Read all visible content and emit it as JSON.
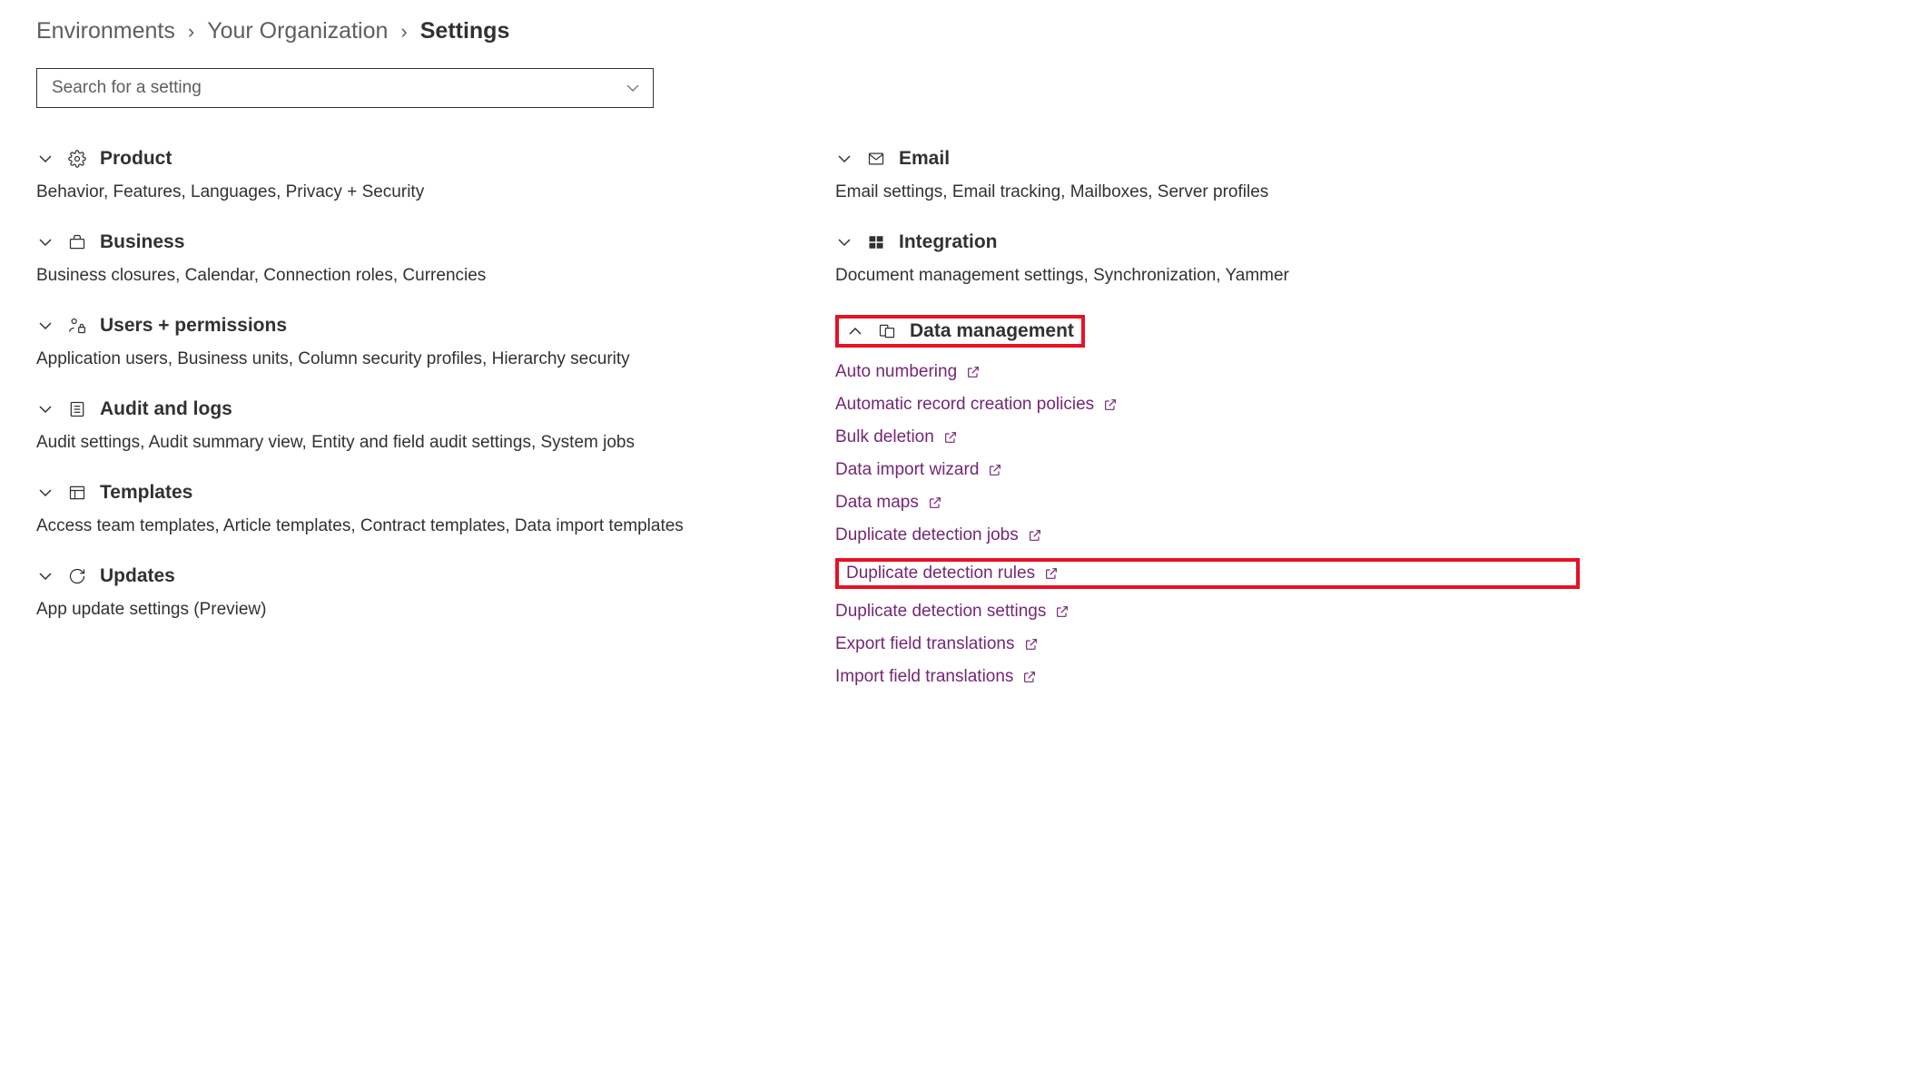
{
  "breadcrumb": {
    "item0": "Environments",
    "item1": "Your Organization",
    "item2": "Settings"
  },
  "search": {
    "placeholder": "Search for a setting"
  },
  "left": {
    "product": {
      "title": "Product",
      "desc": "Behavior, Features, Languages, Privacy + Security"
    },
    "business": {
      "title": "Business",
      "desc": "Business closures, Calendar, Connection roles, Currencies"
    },
    "users": {
      "title": "Users + permissions",
      "desc": "Application users, Business units, Column security profiles, Hierarchy security"
    },
    "audit": {
      "title": "Audit and logs",
      "desc": "Audit settings, Audit summary view, Entity and field audit settings, System jobs"
    },
    "templates": {
      "title": "Templates",
      "desc": "Access team templates, Article templates, Contract templates, Data import templates"
    },
    "updates": {
      "title": "Updates",
      "desc": "App update settings (Preview)"
    }
  },
  "right": {
    "email": {
      "title": "Email",
      "desc": "Email settings, Email tracking, Mailboxes, Server profiles"
    },
    "integration": {
      "title": "Integration",
      "desc": "Document management settings, Synchronization, Yammer"
    },
    "datamgmt": {
      "title": "Data management",
      "links": {
        "l0": "Auto numbering",
        "l1": "Automatic record creation policies",
        "l2": "Bulk deletion",
        "l3": "Data import wizard",
        "l4": "Data maps",
        "l5": "Duplicate detection jobs",
        "l6": "Duplicate detection rules",
        "l7": "Duplicate detection settings",
        "l8": "Export field translations",
        "l9": "Import field translations"
      }
    }
  }
}
